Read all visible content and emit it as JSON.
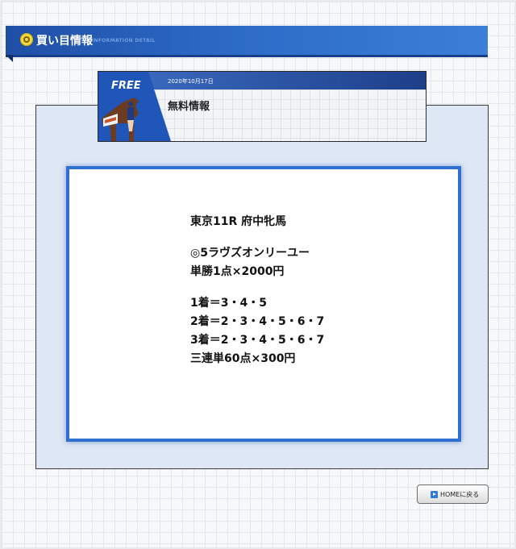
{
  "header": {
    "title": "買い目情報",
    "subtitle": "INFORMATION DETAIL"
  },
  "banner": {
    "badge": "FREE",
    "date": "2020年10月17日",
    "label": "無料情報"
  },
  "content": {
    "race": "東京11R 府中牝馬",
    "pick": "◎5ラヴズオンリーユー",
    "win_bet": "単勝1点×2000円",
    "first": "1着＝3・4・5",
    "second": "2着＝2・3・4・5・6・7",
    "third": "3着＝2・3・4・5・6・7",
    "trifecta": "三連単60点×300円"
  },
  "footer": {
    "home_label": "HOMEに戻る"
  },
  "colors": {
    "accent": "#2f6fd0",
    "ribbon": "#2c6ac6",
    "panel": "#dde7f5"
  }
}
